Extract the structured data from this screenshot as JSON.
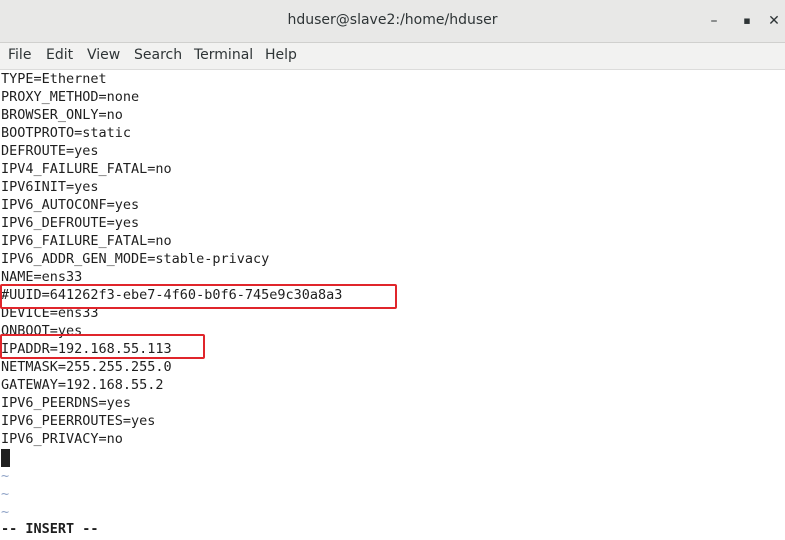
{
  "window": {
    "title": "hduser@slave2:/home/hduser",
    "minimize_glyph": "–",
    "maximize_glyph": "▪",
    "close_glyph": "✕"
  },
  "menu": [
    "File",
    "Edit",
    "View",
    "Search",
    "Terminal",
    "Help"
  ],
  "lines": [
    "TYPE=Ethernet",
    "PROXY_METHOD=none",
    "BROWSER_ONLY=no",
    "BOOTPROTO=static",
    "DEFROUTE=yes",
    "IPV4_FAILURE_FATAL=no",
    "IPV6INIT=yes",
    "IPV6_AUTOCONF=yes",
    "IPV6_DEFROUTE=yes",
    "IPV6_FAILURE_FATAL=no",
    "IPV6_ADDR_GEN_MODE=stable-privacy",
    "NAME=ens33",
    "#UUID=641262f3-ebe7-4f60-b0f6-745e9c30a8a3",
    "DEVICE=ens33",
    "ONBOOT=yes",
    "IPADDR=192.168.55.113",
    "NETMASK=255.255.255.0",
    "GATEWAY=192.168.55.2",
    "IPV6_PEERDNS=yes",
    "IPV6_PEERROUTES=yes",
    "IPV6_PRIVACY=no"
  ],
  "tildes": [
    "~",
    "~",
    "~"
  ],
  "status_line": "-- INSERT --",
  "colors": {
    "highlight": "#e0252b",
    "tilde": "#8fa3c7"
  }
}
